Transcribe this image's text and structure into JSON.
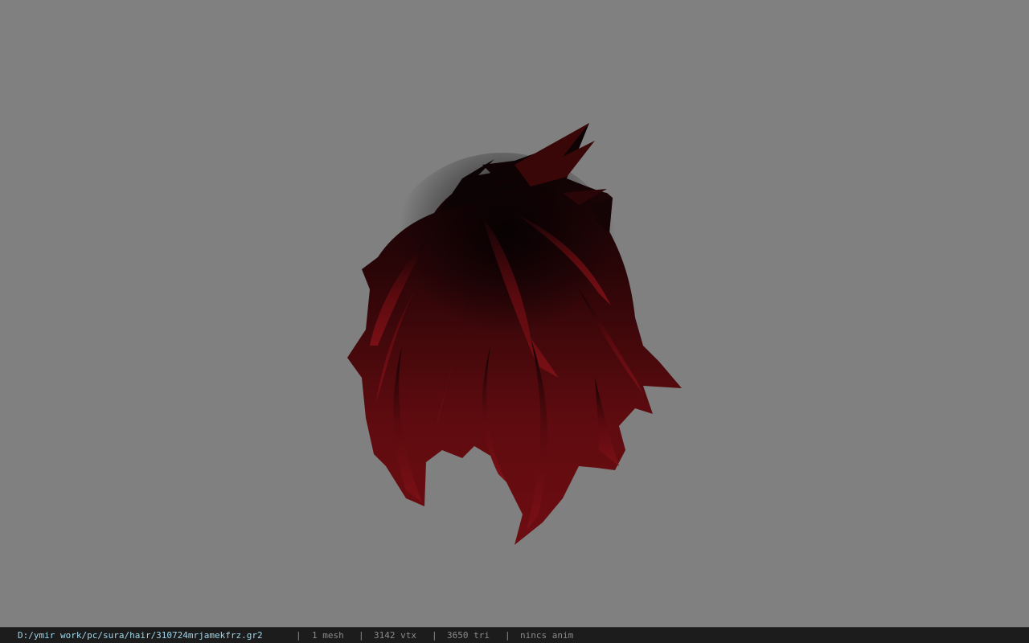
{
  "viewer": {
    "background_color": "#808080",
    "model": {
      "icon": "hair-mesh-icon",
      "primary_color": "#6a0c10",
      "shadow_color": "#0a0304"
    }
  },
  "statusbar": {
    "path": "D:/ymir work/pc/sura/hair/310724mrjamekfrz.gr2",
    "separator": "|",
    "mesh_count": "1 mesh",
    "vertex_count": "3142 vtx",
    "triangle_count": "3650 tri",
    "animation": "nincs anim"
  }
}
